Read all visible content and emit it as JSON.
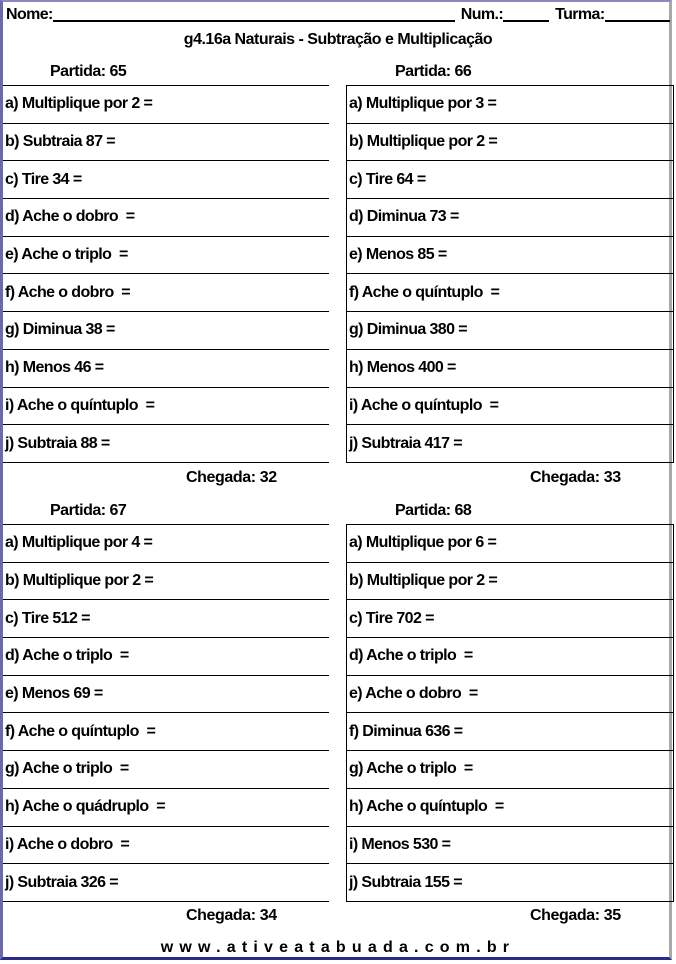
{
  "header": {
    "nome_label": "Nome:",
    "num_label": "Num.:",
    "turma_label": "Turma:"
  },
  "title": "g4.16a Naturais - Subtração e Multiplicação",
  "blocks": [
    {
      "partida_label": "Partida:",
      "partida": "65",
      "items": [
        "a) Multiplique por 2 =",
        "b) Subtraia 87 =",
        "c) Tire 34 =",
        "d) Ache o dobro  =",
        "e) Ache o triplo  =",
        "f) Ache o dobro  =",
        "g) Diminua 38 =",
        "h) Menos 46 =",
        "i) Ache o quíntuplo  =",
        "j) Subtraia 88 ="
      ],
      "chegada_label": "Chegada:",
      "chegada": "32"
    },
    {
      "partida_label": "Partida:",
      "partida": "66",
      "items": [
        "a) Multiplique por 3 =",
        "b) Multiplique por 2 =",
        "c) Tire 64 =",
        "d) Diminua 73 =",
        "e) Menos 85 =",
        "f) Ache o quíntuplo  =",
        "g) Diminua 380 =",
        "h) Menos 400 =",
        "i) Ache o quíntuplo  =",
        "j) Subtraia 417 ="
      ],
      "chegada_label": "Chegada:",
      "chegada": "33"
    },
    {
      "partida_label": "Partida:",
      "partida": "67",
      "items": [
        "a) Multiplique por 4 =",
        "b) Multiplique por 2 =",
        "c) Tire 512 =",
        "d) Ache o triplo  =",
        "e) Menos 69 =",
        "f) Ache o quíntuplo  =",
        "g) Ache o triplo  =",
        "h) Ache o quádruplo  =",
        "i) Ache o dobro  =",
        "j) Subtraia 326 ="
      ],
      "chegada_label": "Chegada:",
      "chegada": "34"
    },
    {
      "partida_label": "Partida:",
      "partida": "68",
      "items": [
        "a) Multiplique por 6 =",
        "b) Multiplique por 2 =",
        "c) Tire 702 =",
        "d) Ache o triplo  =",
        "e) Ache o dobro  =",
        "f) Diminua 636 =",
        "g) Ache o triplo  =",
        "h) Ache o quíntuplo  =",
        "i) Menos 530 =",
        "j) Subtraia 155 ="
      ],
      "chegada_label": "Chegada:",
      "chegada": "35"
    }
  ],
  "footer": "www.ativeatabuada.com.br"
}
